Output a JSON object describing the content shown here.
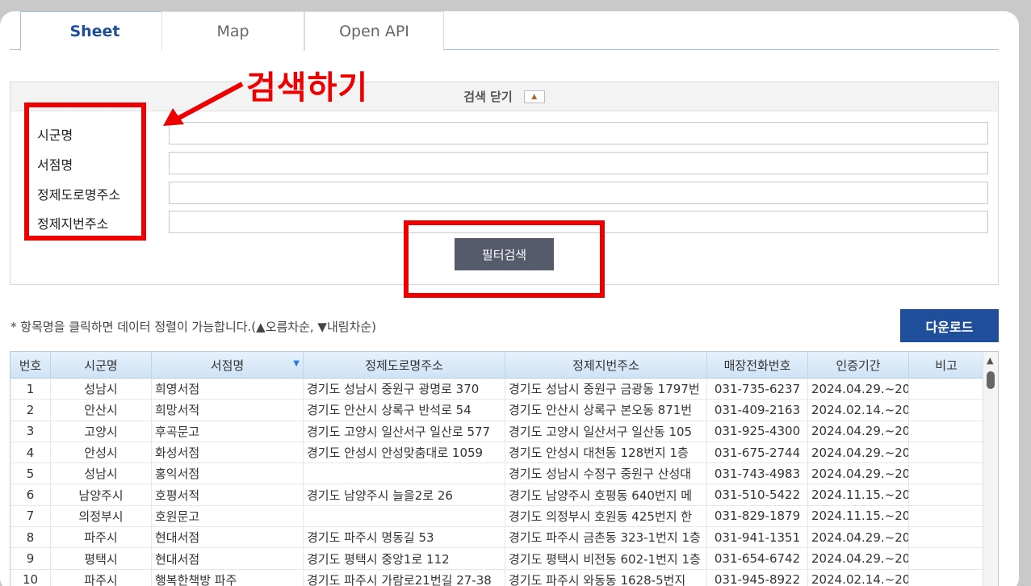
{
  "tabs": [
    {
      "label": "Sheet"
    },
    {
      "label": "Map"
    },
    {
      "label": "Open API"
    }
  ],
  "annotation": {
    "label": "검색하기",
    "color": "#ee0000"
  },
  "search": {
    "header": "검색 닫기",
    "toggle_icon": "▲",
    "fields": [
      {
        "label": "시군명",
        "value": ""
      },
      {
        "label": "서점명",
        "value": ""
      },
      {
        "label": "정제도로명주소",
        "value": ""
      },
      {
        "label": "정제지번주소",
        "value": ""
      }
    ],
    "filter_button": "필터검색"
  },
  "note": "* 항목명을 클릭하면 데이터 정렬이 가능합니다.(▲오름차순, ▼내림차순)",
  "download_button": "다운로드",
  "table": {
    "columns": [
      "번호",
      "시군명",
      "서점명",
      "정제도로명주소",
      "정제지번주소",
      "매장전화번호",
      "인증기간",
      "비고"
    ],
    "sort_icon": "▼",
    "rows": [
      [
        "1",
        "성남시",
        "희영서점",
        "경기도 성남시 중원구 광명로 370",
        "경기도 성남시 중원구 금광동 1797번",
        "031-735-6237",
        "2024.04.29.~20",
        ""
      ],
      [
        "2",
        "안산시",
        "희망서적",
        "경기도 안산시 상록구 반석로 54",
        "경기도 안산시 상록구 본오동 871번",
        "031-409-2163",
        "2024.02.14.~20",
        ""
      ],
      [
        "3",
        "고양시",
        "후곡문고",
        "경기도 고양시 일산서구 일산로 577",
        "경기도 고양시 일산서구 일산동 105",
        "031-925-4300",
        "2024.04.29.~20",
        ""
      ],
      [
        "4",
        "안성시",
        "화성서점",
        "경기도 안성시 안성맞춤대로 1059",
        "경기도 안성시 대천동 128번지 1층",
        "031-675-2744",
        "2024.04.29.~20",
        ""
      ],
      [
        "5",
        "성남시",
        "홍익서점",
        "",
        "경기도 성남시 수정구 중원구 산성대",
        "031-743-4983",
        "2024.04.29.~20",
        ""
      ],
      [
        "6",
        "남양주시",
        "호평서적",
        "경기도 남양주시 늘을2로 26",
        "경기도 남양주시 호평동 640번지 메",
        "031-510-5422",
        "2024.11.15.~20",
        ""
      ],
      [
        "7",
        "의정부시",
        "호원문고",
        "",
        "경기도 의정부시 호원동 425번지 한",
        "031-829-1879",
        "2024.11.15.~20",
        ""
      ],
      [
        "8",
        "파주시",
        "현대서점",
        "경기도 파주시 명동길 53",
        "경기도 파주시 금촌동 323-1번지 1층",
        "031-941-1351",
        "2024.04.29.~20",
        ""
      ],
      [
        "9",
        "평택시",
        "현대서점",
        "경기도 평택시 중앙1로 112",
        "경기도 평택시 비전동 602-1번지 1층",
        "031-654-6742",
        "2024.04.29.~20",
        ""
      ],
      [
        "10",
        "파주시",
        "행복한책방 파주",
        "경기도 파주시 가람로21번길 27-38",
        "경기도 파주시 와동동 1628-5번지",
        "031-945-8922",
        "2024.02.14.~20",
        ""
      ]
    ]
  }
}
